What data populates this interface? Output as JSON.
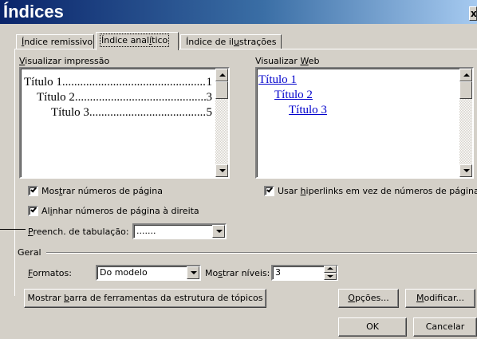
{
  "dialog": {
    "title": "Índices",
    "close_label": "x"
  },
  "tabs": [
    {
      "label_pre": "",
      "label_u": "Í",
      "label_post": "ndice remissivo"
    },
    {
      "label_pre": "Índice anal",
      "label_u": "í",
      "label_post": "tico"
    },
    {
      "label_pre": "Índice de il",
      "label_u": "u",
      "label_post": "strações"
    }
  ],
  "print_preview": {
    "label_u": "V",
    "label_post": "isualizar impressão",
    "items": [
      {
        "text": "Título 1",
        "page": "1"
      },
      {
        "text": "Título 2",
        "page": "3"
      },
      {
        "text": "Título 3",
        "page": "5"
      }
    ]
  },
  "web_preview": {
    "label_pre": "Visualizar ",
    "label_u": "W",
    "label_post": "eb",
    "items": [
      "Título 1",
      "Título 2",
      "Título 3"
    ]
  },
  "options": {
    "show_page_numbers": {
      "pre": "Mos",
      "u": "t",
      "post": "rar números de página",
      "checked": true
    },
    "align_right": {
      "pre": "Al",
      "u": "i",
      "post": "nhar números de página à direita",
      "checked": true
    },
    "use_hyperlinks": {
      "pre": "Usar ",
      "u": "h",
      "post": "iperlinks em vez de números de página",
      "checked": true
    },
    "tab_leader": {
      "u": "P",
      "post": "reench. de tabulação:",
      "value": "......."
    }
  },
  "general": {
    "group_label": "Geral",
    "formats": {
      "u": "F",
      "post": "ormatos:",
      "value": "Do modelo"
    },
    "levels": {
      "pre": "Mo",
      "u": "s",
      "post": "trar níveis:",
      "value": "3"
    }
  },
  "buttons": {
    "outline_toolbar": {
      "pre": "Mostrar ",
      "u": "b",
      "post": "arra de ferramentas da estrutura de tópicos"
    },
    "options": {
      "pre": "",
      "u": "O",
      "post": "pções..."
    },
    "modify": {
      "pre": "",
      "u": "M",
      "post": "odificar..."
    },
    "ok": "OK",
    "cancel": "Cancelar"
  }
}
